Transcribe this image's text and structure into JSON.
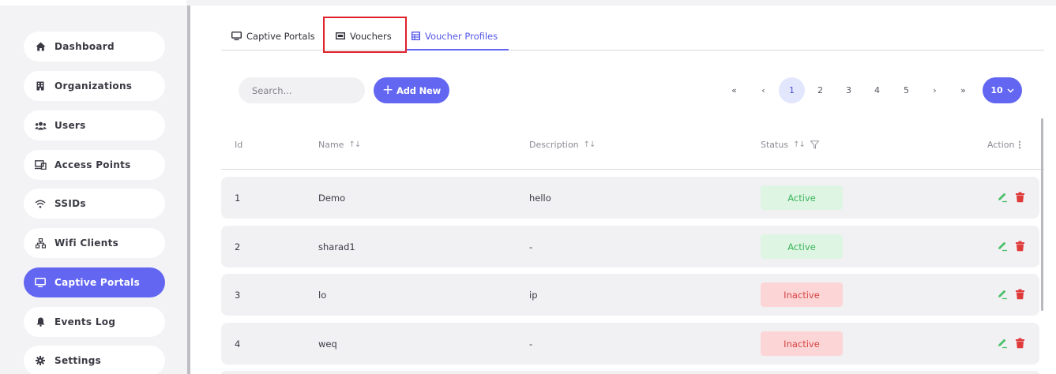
{
  "sidebar": {
    "items": [
      {
        "label": "Dashboard",
        "icon": "home-icon",
        "active": false
      },
      {
        "label": "Organizations",
        "icon": "building-icon",
        "active": false
      },
      {
        "label": "Users",
        "icon": "users-icon",
        "active": false
      },
      {
        "label": "Access Points",
        "icon": "access-point-icon",
        "active": false
      },
      {
        "label": "SSIDs",
        "icon": "wifi-icon",
        "active": false
      },
      {
        "label": "Wifi Clients",
        "icon": "network-icon",
        "active": false
      },
      {
        "label": "Captive Portals",
        "icon": "monitor-icon",
        "active": true
      },
      {
        "label": "Events Log",
        "icon": "bell-icon",
        "active": false
      },
      {
        "label": "Settings",
        "icon": "gear-icon",
        "active": false
      }
    ]
  },
  "tabs": [
    {
      "label": "Captive Portals",
      "icon": "monitor-icon"
    },
    {
      "label": "Vouchers",
      "icon": "ticket-icon"
    },
    {
      "label": "Voucher Profiles",
      "icon": "table-icon",
      "selected": true
    }
  ],
  "toolbar": {
    "search_placeholder": "Search...",
    "add_label": "Add New"
  },
  "pagination": {
    "first": "«",
    "prev": "‹",
    "pages": [
      "1",
      "2",
      "3",
      "4",
      "5"
    ],
    "current": "1",
    "next": "›",
    "last": "»",
    "rows_per_page": "10"
  },
  "table": {
    "columns": [
      "Id",
      "Name",
      "Description",
      "Status",
      "Action"
    ],
    "rows": [
      {
        "id": "1",
        "name": "Demo",
        "description": "hello",
        "status": "Active"
      },
      {
        "id": "2",
        "name": "sharad1",
        "description": "-",
        "status": "Active"
      },
      {
        "id": "3",
        "name": "lo",
        "description": "ip",
        "status": "Inactive"
      },
      {
        "id": "4",
        "name": "weq",
        "description": "-",
        "status": "Inactive"
      }
    ]
  },
  "colors": {
    "accent": "#6366f1",
    "active_bg": "#dff5e3",
    "active_text": "#37b45a",
    "inactive_bg": "#fcd6d6",
    "inactive_text": "#d84343",
    "edit_icon": "#4cc06a",
    "delete_icon": "#e03b3b",
    "highlight_box": "#e0202a"
  }
}
